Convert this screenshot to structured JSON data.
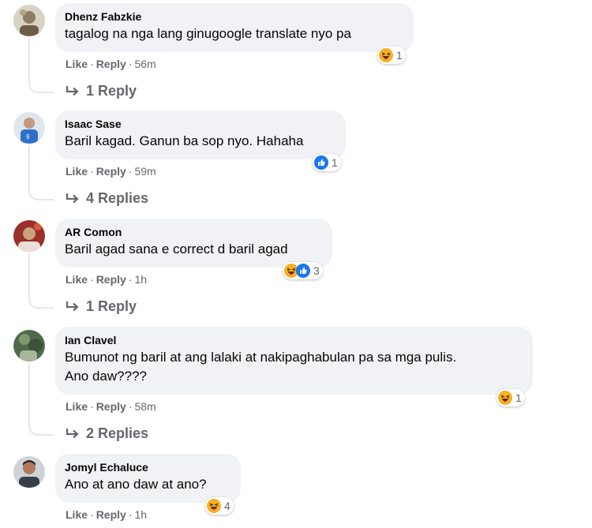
{
  "comments": [
    {
      "author": "Dhenz Fabzkie",
      "text": "tagalog na nga lang ginugoogle translate nyo pa",
      "reactions": [
        "haha-icon"
      ],
      "reaction_count": "1",
      "like_label": "Like",
      "reply_label": "Reply",
      "time": "56m",
      "replies_label": "1 Reply"
    },
    {
      "author": "Isaac Sase",
      "text": "Baril kagad. Ganun ba sop nyo. Hahaha",
      "reactions": [
        "like-icon"
      ],
      "reaction_count": "1",
      "like_label": "Like",
      "reply_label": "Reply",
      "time": "59m",
      "replies_label": "4 Replies"
    },
    {
      "author": "AR Comon",
      "text": "Baril agad sana e correct d baril agad",
      "reactions": [
        "haha-icon",
        "like-icon"
      ],
      "reaction_count": "3",
      "like_label": "Like",
      "reply_label": "Reply",
      "time": "1h",
      "replies_label": "1 Reply"
    },
    {
      "author": "Ian Clavel",
      "text_line1": "Bumunot ng baril at ang lalaki at nakipaghabulan pa sa mga pulis.",
      "text_line2": "Ano daw????",
      "reactions": [
        "haha-icon"
      ],
      "reaction_count": "1",
      "like_label": "Like",
      "reply_label": "Reply",
      "time": "58m",
      "replies_label": "2 Replies"
    },
    {
      "author": "Jomyl Echaluce",
      "text": "Ano at ano daw at ano?",
      "reactions": [
        "haha-icon"
      ],
      "reaction_count": "4",
      "like_label": "Like",
      "reply_label": "Reply",
      "time": "1h"
    }
  ],
  "separator": "·",
  "colors": {
    "bubble": "#f0f2f5",
    "meta": "#65676b",
    "like_blue": "#1877f2",
    "haha_yellow": "#f7b125"
  }
}
